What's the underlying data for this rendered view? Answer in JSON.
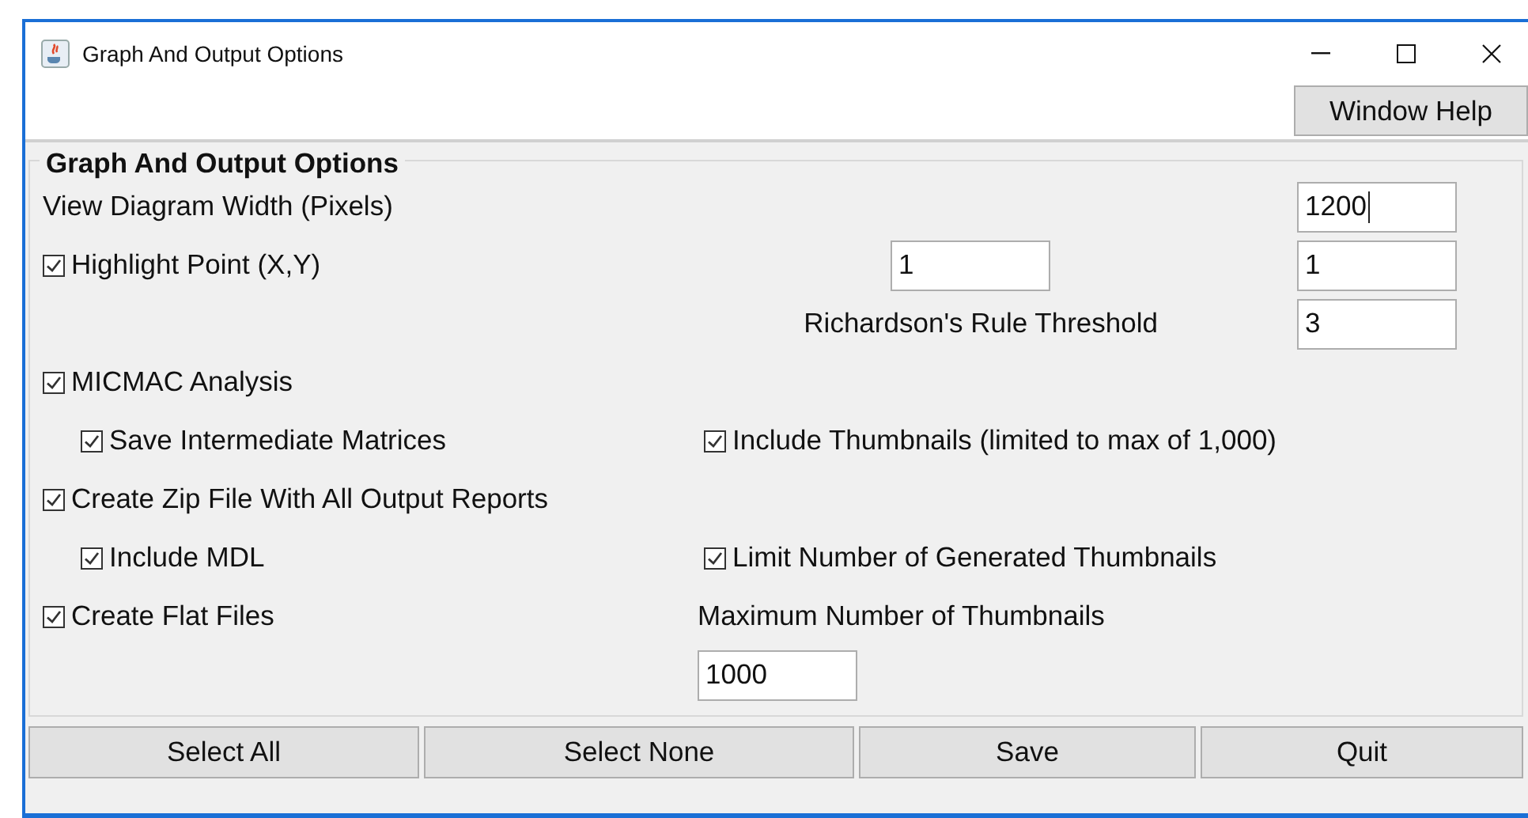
{
  "window": {
    "title": "Graph And Output Options"
  },
  "help_button": "Window Help",
  "group": {
    "title": "Graph And Output Options",
    "rows": [
      {
        "items": [
          {
            "kind": "label",
            "text": "View Diagram Width (Pixels)"
          },
          {
            "kind": "field",
            "value": "1200",
            "focused": true
          }
        ]
      },
      {
        "items": [
          {
            "kind": "checkbox",
            "label": "Highlight Point (X,Y)",
            "checked": true
          },
          {
            "kind": "field",
            "value": "1",
            "focused": false
          },
          {
            "kind": "field",
            "value": "1",
            "focused": false
          }
        ]
      },
      {
        "items": [
          {
            "kind": "label",
            "text": "Richardson's Rule Threshold"
          },
          {
            "kind": "field",
            "value": "3",
            "focused": false
          }
        ]
      },
      {
        "items": [
          {
            "kind": "checkbox",
            "label": "MICMAC Analysis",
            "checked": true
          }
        ]
      },
      {
        "items": [
          {
            "kind": "checkbox",
            "label": "Save Intermediate Matrices",
            "checked": true
          },
          {
            "kind": "checkbox",
            "label": "Include Thumbnails (limited to max of 1,000)",
            "checked": true
          }
        ]
      },
      {
        "items": [
          {
            "kind": "checkbox",
            "label": "Create Zip File With All Output Reports",
            "checked": true
          }
        ]
      },
      {
        "items": [
          {
            "kind": "checkbox",
            "label": "Include MDL",
            "checked": true
          },
          {
            "kind": "checkbox",
            "label": "Limit Number of Generated Thumbnails",
            "checked": true
          }
        ]
      },
      {
        "items": [
          {
            "kind": "checkbox",
            "label": "Create Flat Files",
            "checked": true
          },
          {
            "kind": "label",
            "text": "Maximum Number of Thumbnails"
          }
        ]
      },
      {
        "items": [
          {
            "kind": "field",
            "value": "1000",
            "focused": false
          }
        ]
      }
    ]
  },
  "buttons": [
    "Select All",
    "Select None",
    "Save",
    "Quit"
  ]
}
